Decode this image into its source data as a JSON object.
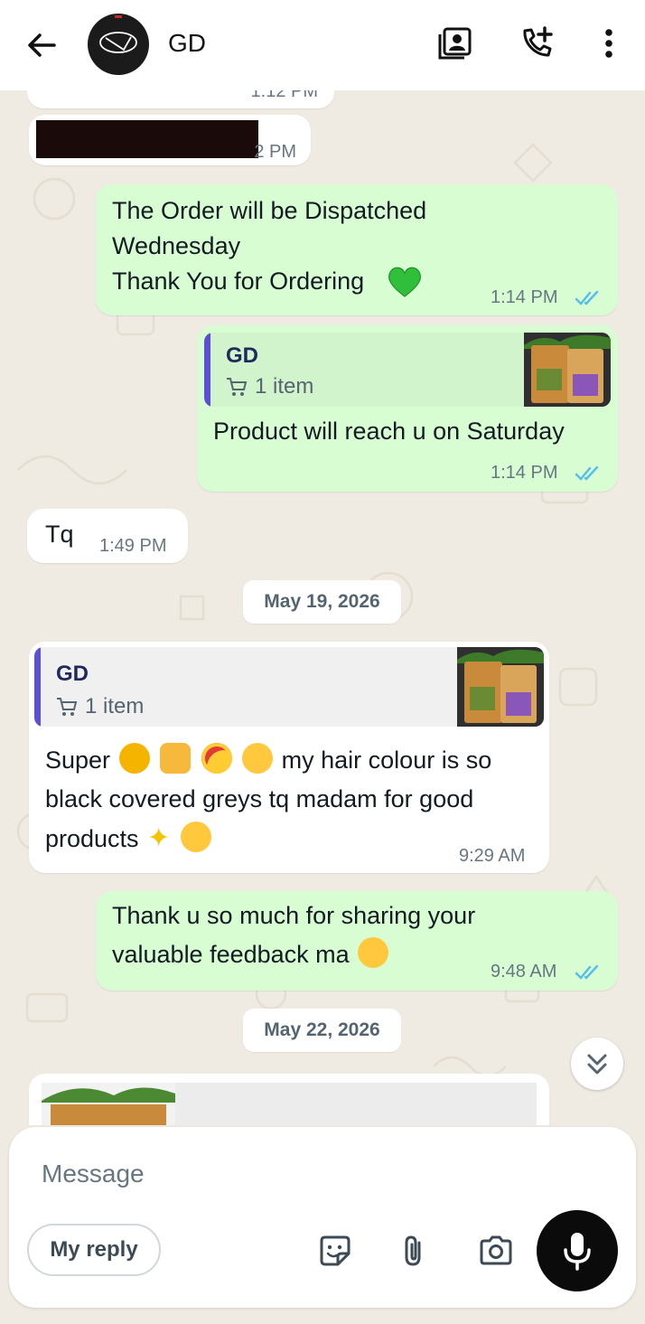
{
  "header": {
    "contact_name": "GD",
    "back_icon": "arrow-left-icon",
    "icons": [
      "contact-card-icon",
      "add-call-icon",
      "more-vert-icon"
    ]
  },
  "messages": {
    "partial_top_time": "1:12 PM",
    "redacted_time_fragment": "2 PM",
    "m1": {
      "text": "The Order will be Dispatched\nWednesday\nThank You for Ordering",
      "emoji": "green-heart",
      "time": "1:14 PM"
    },
    "m2": {
      "quote_name": "GD",
      "quote_sub": "1 item",
      "text": "Product will reach u on Saturday",
      "time": "1:14 PM"
    },
    "m3": {
      "text": "Tq",
      "time": "1:49 PM"
    },
    "date1": "May 19, 2026",
    "m4": {
      "quote_name": "GD",
      "quote_sub": "1 item",
      "line1_a": "Super",
      "line1_b": "my hair colour is so",
      "line2": "black covered greys tq madam for good",
      "line3": "products",
      "time": "9:29 AM"
    },
    "m5": {
      "line1": "Thank u so much for sharing your",
      "line2": "valuable feedback ma",
      "time": "9:48 AM"
    },
    "date2": "May 22, 2026"
  },
  "composer": {
    "placeholder": "Message",
    "reply_chip": "My reply",
    "icons": [
      "sticker-icon",
      "paperclip-icon",
      "camera-icon",
      "mic-icon"
    ]
  },
  "colors": {
    "outgoing": "#d9fdd3",
    "incoming": "#ffffff",
    "read_ticks": "#53bdeb",
    "quote_bar": "#5b4fd6"
  }
}
